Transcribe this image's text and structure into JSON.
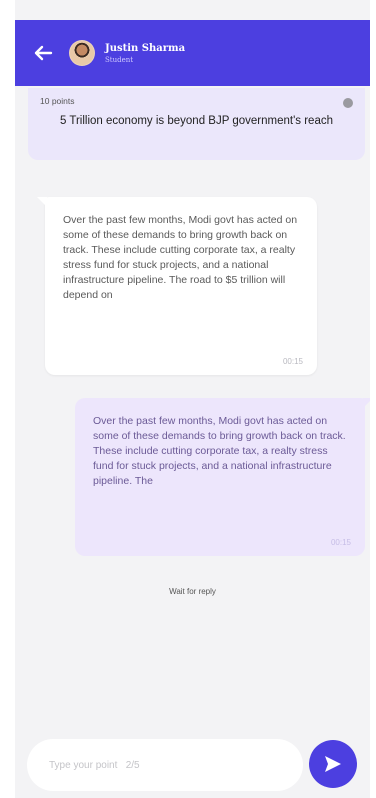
{
  "header": {
    "user_name": "Justin Sharma",
    "user_role": "Student",
    "accent_color": "#4c3fe0",
    "back_icon": "arrow-left-icon"
  },
  "topic": {
    "points": "10 points",
    "title": "5 Trillion economy is beyond BJP government's reach",
    "info_icon": "info-icon"
  },
  "messages": [
    {
      "direction": "incoming",
      "text": "Over the past few months, Modi govt has acted on some of these demands to bring growth back on track. These include cutting corporate tax, a realty stress fund for stuck projects, and a national infrastructure pipeline. The road to $5 trillion will depend on",
      "time": "00:15"
    },
    {
      "direction": "outgoing",
      "text": "Over the past few months, Modi govt has acted on some of these demands to bring growth back on track. These include cutting corporate tax, a realty stress fund for stuck projects, and a national infrastructure pipeline. The",
      "time": "00:15"
    }
  ],
  "status": {
    "wait_text": "Wait for reply"
  },
  "composer": {
    "placeholder": "Type your point   2/5",
    "send_icon": "send-icon"
  }
}
